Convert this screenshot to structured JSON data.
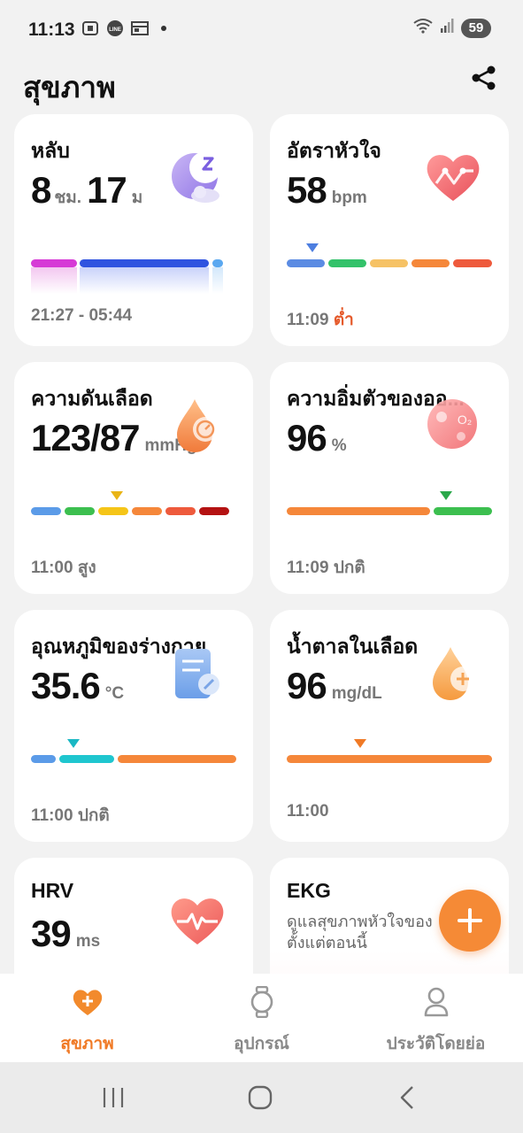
{
  "status_bar": {
    "time": "11:13",
    "battery": "59"
  },
  "header": {
    "title": "สุขภาพ"
  },
  "cards": {
    "sleep": {
      "title": "หลับ",
      "hours": "8",
      "hours_unit": "ชม.",
      "minutes": "17",
      "minutes_unit": "ม",
      "footer": "21:27 - 05:44"
    },
    "heart_rate": {
      "title": "อัตราหัวใจ",
      "value": "58",
      "unit": "bpm",
      "time": "11:09",
      "status": "ต่ำ"
    },
    "blood_pressure": {
      "title": "ความดันเลือด",
      "value": "123/87",
      "unit": "mmHg",
      "time": "11:00",
      "status": "สูง"
    },
    "spo2": {
      "title": "ความอิ่มตัวของออ...",
      "value": "96",
      "unit": "%",
      "time": "11:09",
      "status": "ปกติ"
    },
    "temperature": {
      "title": "อุณหภูมิของร่างกาย",
      "value": "35.6",
      "unit": "°C",
      "time": "11:00",
      "status": "ปกติ"
    },
    "glucose": {
      "title": "น้ำตาลในเลือด",
      "value": "96",
      "unit": "mg/dL",
      "time": "11:00"
    },
    "hrv": {
      "title": "HRV",
      "value": "39",
      "unit": "ms"
    },
    "ekg": {
      "title": "EKG",
      "description_line1": "ดูแลสุขภาพหัวใจของ",
      "description_line2": "ตั้งแต่ตอนนี้"
    }
  },
  "bottom_nav": [
    {
      "label": "สุขภาพ",
      "icon": "heart-plus-icon",
      "active": true
    },
    {
      "label": "อุปกรณ์",
      "icon": "watch-icon",
      "active": false
    },
    {
      "label": "ประวัติโดยย่อ",
      "icon": "profile-icon",
      "active": false
    }
  ],
  "colors": {
    "accent": "#f07a26",
    "low": "#e55a2b"
  }
}
